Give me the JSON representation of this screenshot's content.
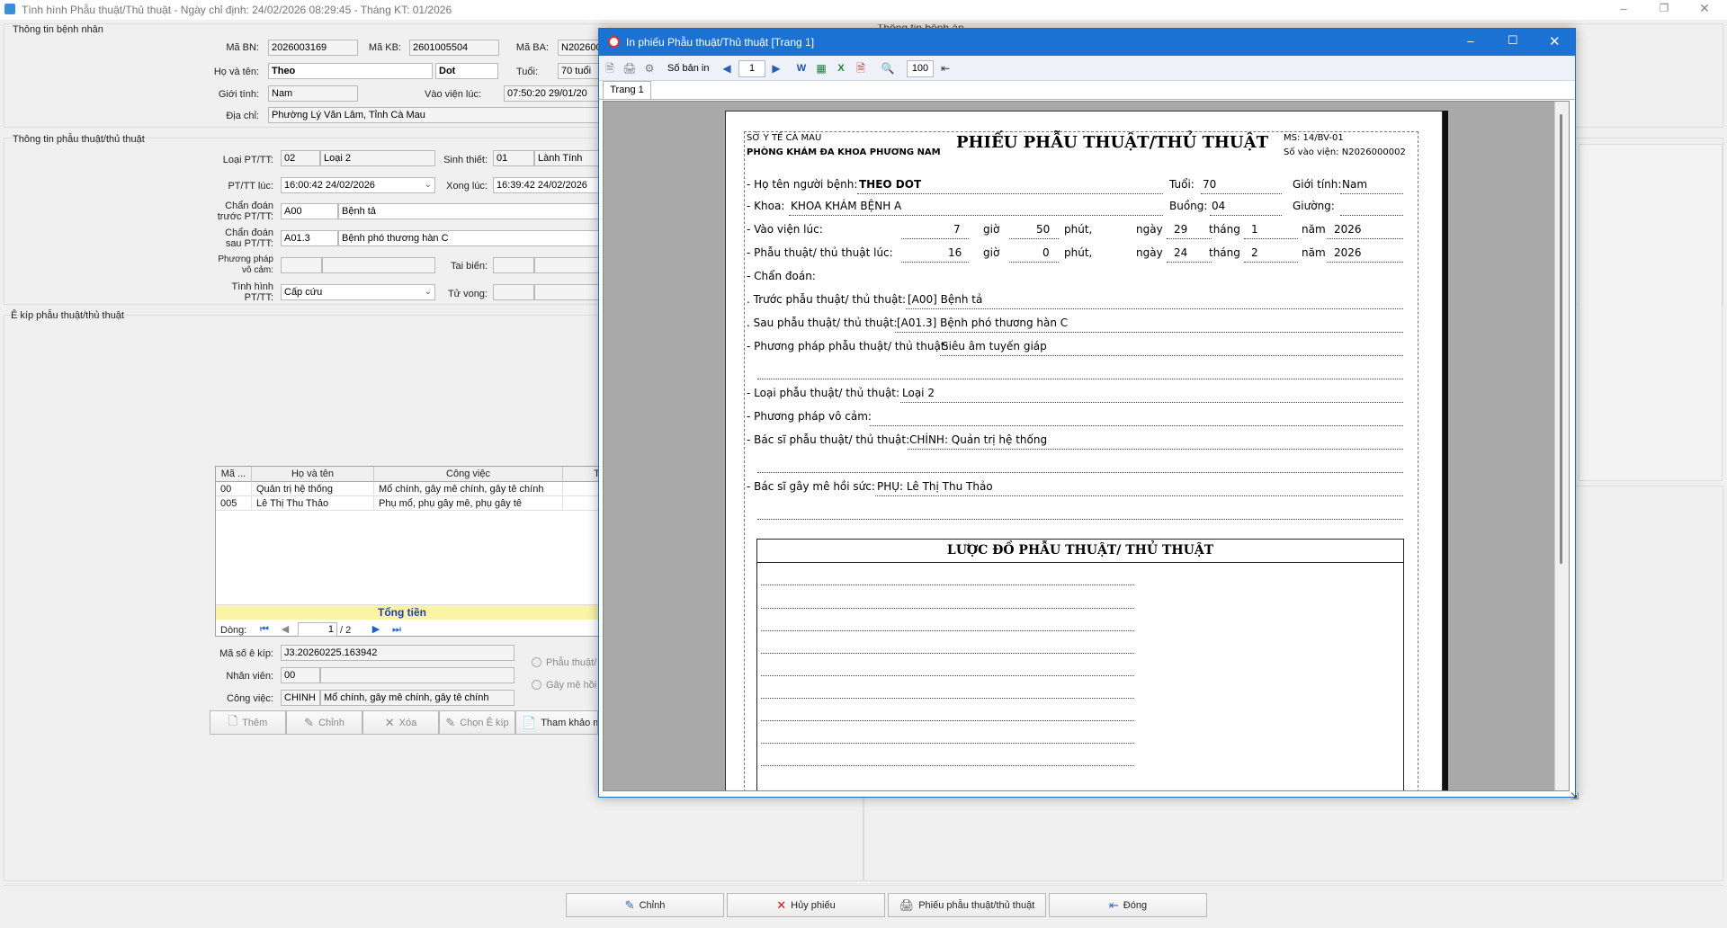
{
  "main_window": {
    "title": "Tình hình Phẫu thuật/Thủ thuật - Ngày chỉ định: 24/02/2026 08:29:45 - Tháng KT: 01/2026",
    "hidden_center_title": "Thông tin bệnh án"
  },
  "patient_section": {
    "group_title": "Thông tin bệnh nhân",
    "ma_bn_label": "Mã BN:",
    "ma_bn": "2026003169",
    "ma_kb_label": "Mã KB:",
    "ma_kb": "2601005504",
    "ma_ba_label": "Mã BA:",
    "ma_ba": "N202600",
    "ho_ten_label": "Họ và tên:",
    "ho": "Theo",
    "ten": "Dot",
    "tuoi_label": "Tuổi:",
    "tuoi": "70 tuổi",
    "gioi_tinh_label": "Giới tính:",
    "gioi_tinh": "Nam",
    "vao_vien_label": "Vào viện lúc:",
    "vao_vien": "07:50:20 29/01/20",
    "dia_chi_label": "Địa chỉ:",
    "dia_chi": "Phường Lý Văn Lâm, Tỉnh Cà Mau"
  },
  "procedure_section": {
    "group_title": "Thông tin phẫu thuật/thủ thuật",
    "loai_label": "Loại PT/TT:",
    "loai_code": "02",
    "loai_name": "Loại 2",
    "sinh_thiet_label": "Sinh thiết:",
    "sinh_thiet_code": "01",
    "sinh_thiet_name": "Lành Tính",
    "pttt_luc_label": "PT/TT lúc:",
    "pttt_luc": "16:00:42 24/02/2026",
    "xong_luc_label": "Xong lúc:",
    "xong_luc": "16:39:42 24/02/2026",
    "cd_truoc_label_1": "Chẩn đoán",
    "cd_truoc_label_2": "trước PT/TT:",
    "cd_truoc_code": "A00",
    "cd_truoc_name": "Bệnh tả",
    "cd_sau_label_1": "Chẩn đoán",
    "cd_sau_label_2": "sau PT/TT:",
    "cd_sau_code": "A01.3",
    "cd_sau_name": "Bệnh phó thương hàn C",
    "pp_vo_cam_label_1": "Phương pháp",
    "pp_vo_cam_label_2": "vô cảm:",
    "tai_bien_label": "Tai biến:",
    "tinh_hinh_label_1": "Tình hình",
    "tinh_hinh_label_2": "PT/TT:",
    "tinh_hinh": "Cấp cứu",
    "tu_vong_label": "Tử vong:"
  },
  "team_section": {
    "group_title": "Ê kíp phẫu thuật/thủ thuật",
    "columns": [
      "Mã ...",
      "Họ và tên",
      "Công việc",
      "T"
    ],
    "rows": [
      {
        "ma": "00",
        "ho_ten": "Quản trị hệ thống",
        "cong_viec": "Mổ chính, gây mê chính, gây tê chính"
      },
      {
        "ma": "005",
        "ho_ten": "Lê Thị Thu Thảo",
        "cong_viec": "Phụ mổ, phụ gây mê, phụ gây tê"
      }
    ],
    "total_label": "Tổng tiền",
    "nav_label": "Dòng:",
    "nav_current": "1",
    "nav_total": "/ 2",
    "ekip_code_label": "Mã số ê kíp:",
    "ekip_code": "J3.20260225.163942",
    "nhan_vien_label": "Nhân viên:",
    "nhan_vien_code": "00",
    "cong_viec_label": "Công việc:",
    "cong_viec_code": "CHINH",
    "cong_viec_name": "Mổ chính, gây mê chính, gây tê chính",
    "radio_1": "Phẫu thuật/",
    "radio_2": "Gây mê hồi",
    "btn_them": "Thêm",
    "btn_chinh": "Chỉnh",
    "btn_xoa": "Xóa",
    "btn_chon": "Chọn Ê kíp",
    "btn_tham_khao": "Tham khảo m"
  },
  "bottom_buttons": {
    "chinh": "Chỉnh",
    "huy": "Hủy phiếu",
    "phieu": "Phiếu phẫu thuật/thủ thuật",
    "dong": "Đóng"
  },
  "print_window": {
    "title": "In phiếu Phẫu thuật/Thủ thuật [Trang 1]",
    "copies_label": "Số bản in",
    "page_value": "1",
    "zoom_value": "100",
    "tab_label": "Trang 1"
  },
  "paper": {
    "org_line1": "SỞ Y TẾ CÀ MAU",
    "org_line2": "PHÒNG KHÁM ĐA KHOA PHƯƠNG NAM",
    "title": "PHIẾU PHẪU THUẬT/THỦ THUẬT",
    "ms": "MS: 14/BV-01",
    "so_vao_vien": "Số vào viện: N2026000002",
    "ho_ten_label": "- Họ tên người bệnh:",
    "ho_ten": "THEO DOT",
    "tuoi_label": "Tuổi:",
    "tuoi": "70",
    "gioi_tinh_label": "Giới tính:",
    "gioi_tinh": "Nam",
    "khoa_label": "- Khoa:",
    "khoa": "KHOA KHÁM BỆNH A",
    "buong_label": "Buồng:",
    "buong": "04",
    "giuong_label": "Giường:",
    "vao_vien_label": "- Vào viện lúc:",
    "vv_gio": "7",
    "vv_phut": "50",
    "vv_ngay": "29",
    "vv_thang": "1",
    "vv_nam": "2026",
    "pttt_label": "- Phẫu thuật/ thủ thuật lúc:",
    "pt_gio": "16",
    "pt_phut": "0",
    "pt_ngay": "24",
    "pt_thang": "2",
    "pt_nam": "2026",
    "gio": "giờ",
    "phut": "phút,",
    "ngay": "ngày",
    "thang": "tháng",
    "nam": "năm",
    "chan_doan_label": "- Chẩn đoán:",
    "truoc_label": ". Trước phẫu thuật/ thủ thuật:",
    "truoc": "[A00] Bệnh tả",
    "sau_label": ". Sau phẫu thuật/ thủ thuật:",
    "sau": "[A01.3] Bệnh phó thương hàn C",
    "pp_label": "- Phương pháp phẫu thuật/ thủ thuật:",
    "pp": "Siêu âm tuyến giáp",
    "loai_label": "- Loại phẫu thuật/ thủ thuật:",
    "loai": "Loại 2",
    "vo_cam_label": "- Phương pháp vô cảm:",
    "bac_si_label": "- Bác sĩ phẫu thuật/ thủ thuật:",
    "bac_si": "CHÍNH: Quản trị hệ thống",
    "gay_me_label": "- Bác sĩ gây mê hồi sức:",
    "gay_me": "PHỤ: Lê Thị Thu Thảo",
    "diagram_title": "LƯỢC ĐỒ PHẪU THUẬT/ THỦ THUẬT"
  }
}
